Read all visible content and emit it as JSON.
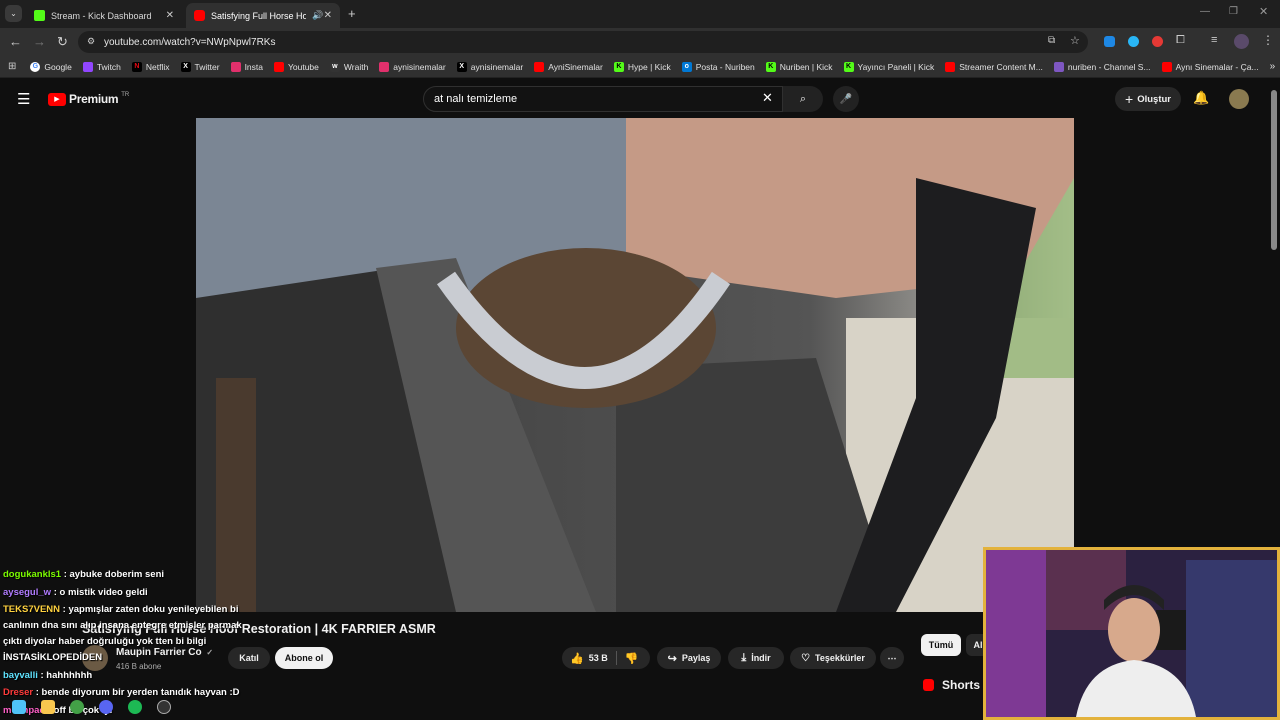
{
  "tabs": [
    {
      "title": "Stream - Kick Dashboard",
      "active": false
    },
    {
      "title": "Satisfying Full Horse Hoof R",
      "active": true
    }
  ],
  "browser": {
    "url": "youtube.com/watch?v=NWpNpwl7RKs",
    "bookmarks": [
      "Google",
      "Twitch",
      "Netflix",
      "Twitter",
      "Insta",
      "Youtube",
      "Wraith",
      "aynisinemalar",
      "aynisinemalar",
      "AyniSinemalar",
      "Hype | Kick",
      "Posta - Nuriben",
      "Nuriben | Kick",
      "Yayıncı Paneli | Kick",
      "Streamer Content M...",
      "nuriben - Channel S...",
      "Aynı Sinemalar - Ça..."
    ]
  },
  "youtube": {
    "logo_text": "Premium",
    "region": "TR",
    "search_value": "at nalı temizleme",
    "create_label": "Oluştur"
  },
  "video": {
    "title": "Satisfying Full Horse Hoof Restoration | 4K FARRIER ASMR",
    "channel": "Maupin Farrier Co",
    "subscribers": "416 B abone",
    "join_label": "Katıl",
    "subscribe_label": "Abone ol",
    "likes": "53 B",
    "share_label": "Paylaş",
    "download_label": "İndir",
    "thanks_label": "Teşekkürler",
    "filter_all": "Tümü",
    "filter_next": "Al",
    "shorts_label": "Shorts"
  },
  "chat": [
    {
      "user": "dogukankls1",
      "text": " : aybuke doberim seni",
      "color": "#7CFC00"
    },
    {
      "user": "aysegul_w",
      "text": " : o mistik video geldi",
      "color": "#b07bff"
    },
    {
      "user": "TEKS7VENN",
      "text": " : yapmışlar zaten doku yenileyebilen bi",
      "color": "#ffd23f"
    },
    {
      "user": "",
      "text": "canlının dna sını alıp insana entegre etmişler parmak",
      "color": "#fff"
    },
    {
      "user": "",
      "text": "çıktı diyolar haber doğruluğu yok tten bi bilgi",
      "color": "#fff"
    },
    {
      "user": "",
      "text": "İNSTASİKLOPEDİDEN",
      "color": "#fff"
    },
    {
      "user": "bayvalli",
      "text": " : hahhhhhh",
      "color": "#5fe3ff"
    },
    {
      "user": "Dreser",
      "text": " : bende diyorum bir yerden tanıdık hayvan :D",
      "color": "#ff3b3b"
    },
    {
      "user": "metmpao",
      "text": " : off bu çok iyi",
      "color": "#ff5fc8"
    }
  ],
  "colors": {
    "kick_green": "#53fc18",
    "youtube_red": "#ff0000",
    "webcam_border": "#e3b23c"
  }
}
